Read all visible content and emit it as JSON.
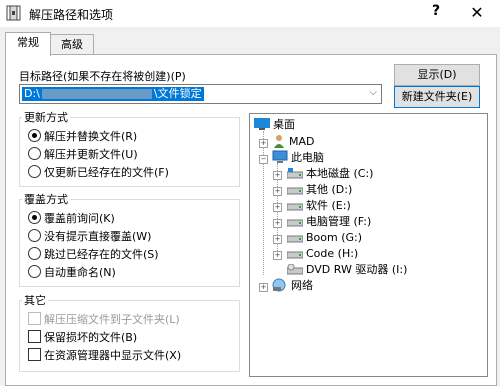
{
  "window": {
    "title": "解压路径和选项",
    "help_label": "?",
    "close_label": "✕"
  },
  "tabs": [
    {
      "label": "常规"
    },
    {
      "label": "高级"
    }
  ],
  "target": {
    "label": "目标路径(如果不存在将被创建)(P)",
    "path_prefix": "D:\\",
    "path_suffix": "\\文件锁定"
  },
  "buttons": {
    "show": "显示(D)",
    "new_folder": "新建文件夹(E)"
  },
  "update_mode": {
    "legend": "更新方式",
    "options": [
      {
        "label": "解压并替换文件(R)",
        "selected": true
      },
      {
        "label": "解压并更新文件(U)",
        "selected": false
      },
      {
        "label": "仅更新已经存在的文件(F)",
        "selected": false
      }
    ]
  },
  "overwrite_mode": {
    "legend": "覆盖方式",
    "options": [
      {
        "label": "覆盖前询问(K)",
        "selected": true
      },
      {
        "label": "没有提示直接覆盖(W)",
        "selected": false
      },
      {
        "label": "跳过已经存在的文件(S)",
        "selected": false
      },
      {
        "label": "自动重命名(N)",
        "selected": false
      }
    ]
  },
  "misc": {
    "legend": "其它",
    "options": [
      {
        "label": "解压压缩文件到子文件夹(L)",
        "checked": false,
        "disabled": true
      },
      {
        "label": "保留损坏的文件(B)",
        "checked": false,
        "disabled": false
      },
      {
        "label": "在资源管理器中显示文件(X)",
        "checked": false,
        "disabled": false
      }
    ]
  },
  "tree": {
    "desktop": "桌面",
    "user": "MAD",
    "computer": "此电脑",
    "drives": [
      {
        "label": "本地磁盘 (C:)",
        "icon": "local-disk-icon"
      },
      {
        "label": "其他 (D:)",
        "icon": "drive-icon"
      },
      {
        "label": "软件 (E:)",
        "icon": "drive-icon"
      },
      {
        "label": "电脑管理 (F:)",
        "icon": "drive-icon"
      },
      {
        "label": "Boom (G:)",
        "icon": "drive-icon"
      },
      {
        "label": "Code (H:)",
        "icon": "drive-icon"
      },
      {
        "label": "DVD RW 驱动器 (I:)",
        "icon": "dvd-drive-icon"
      }
    ],
    "network": "网络"
  },
  "colors": {
    "accent": "#0078d7",
    "folder": "#e8b64c"
  }
}
